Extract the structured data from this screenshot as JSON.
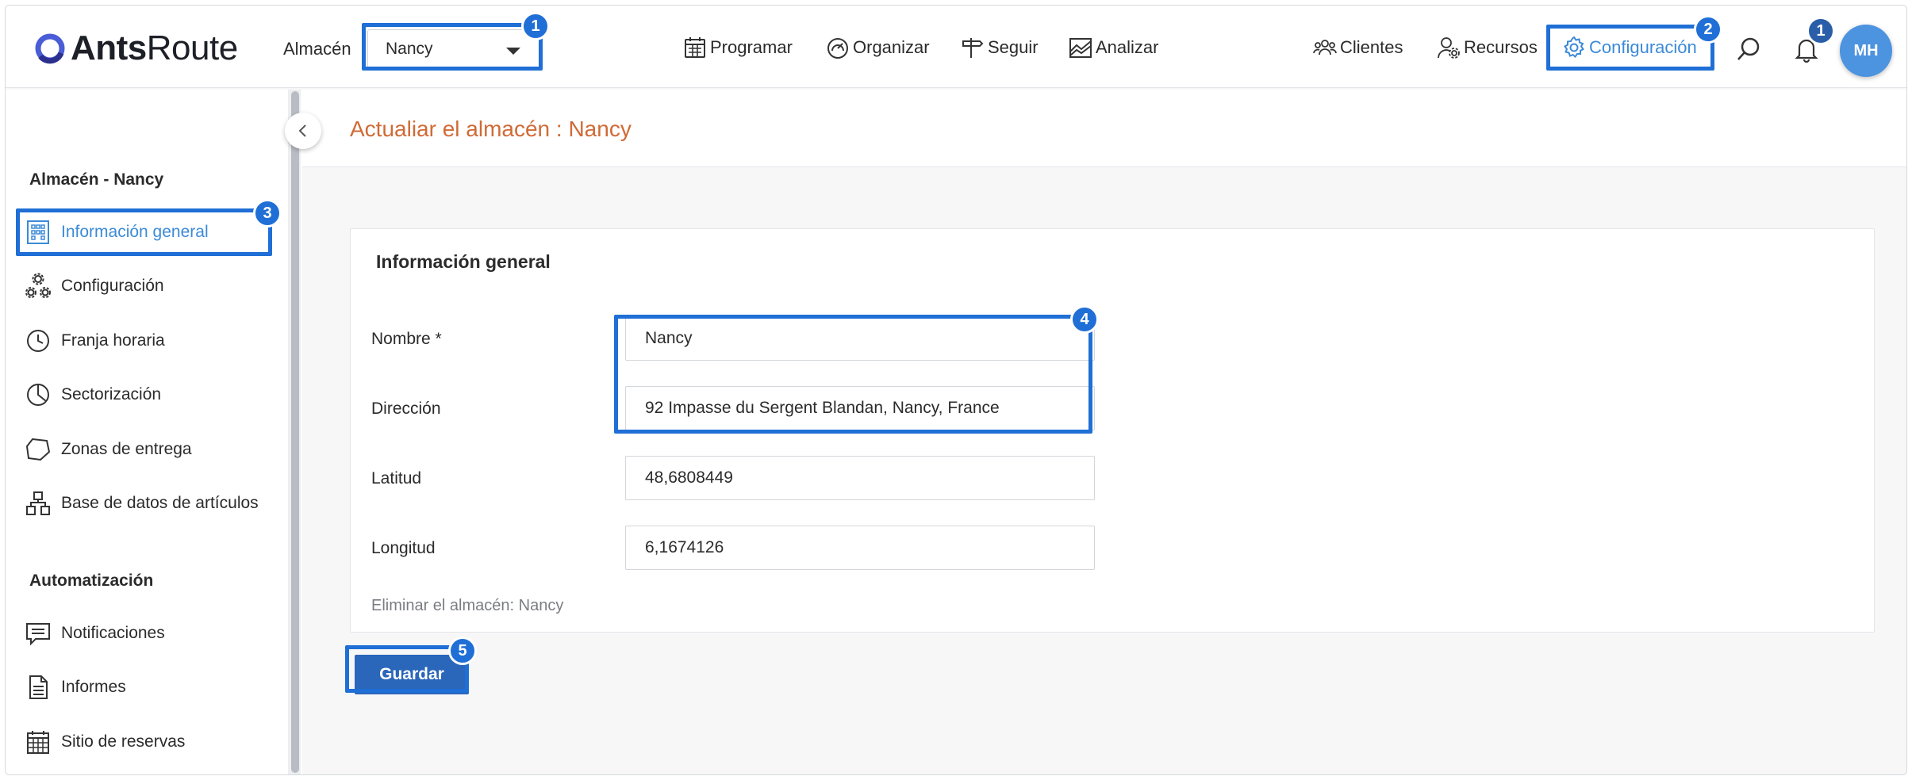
{
  "brand": {
    "bold": "Ants",
    "light": "Route"
  },
  "header": {
    "warehouse_label": "Almacén",
    "warehouse_selected": "Nancy",
    "nav": [
      "Programar",
      "Organizar",
      "Seguir",
      "Analizar"
    ],
    "right_nav": [
      "Clientes",
      "Recursos",
      "Configuración"
    ],
    "notifications_count": "1",
    "avatar_initials": "MH"
  },
  "annotations": [
    "1",
    "2",
    "3",
    "4",
    "5"
  ],
  "sidebar": {
    "section1": "Almacén - Nancy",
    "items": [
      "Información general",
      "Configuración",
      "Franja horaria",
      "Sectorización",
      "Zonas de entrega",
      "Base de datos de artículos"
    ],
    "section2": "Automatización",
    "items2": [
      "Notificaciones",
      "Informes",
      "Sitio de reservas"
    ]
  },
  "page": {
    "title": "Actualiar el almacén : Nancy",
    "card_title": "Información general",
    "fields": [
      {
        "label": "Nombre *",
        "value": "Nancy"
      },
      {
        "label": "Dirección",
        "value": "92 Impasse du Sergent Blandan, Nancy, France"
      },
      {
        "label": "Latitud",
        "value": "48,6808449"
      },
      {
        "label": "Longitud",
        "value": "6,1674126"
      }
    ],
    "delete_link": "Eliminar el almacén: Nancy",
    "save_label": "Guardar"
  },
  "colors": {
    "accent": "#3b8ad8",
    "highlight": "#1f6fd6",
    "title": "#d06a36",
    "save": "#2a66ba"
  }
}
